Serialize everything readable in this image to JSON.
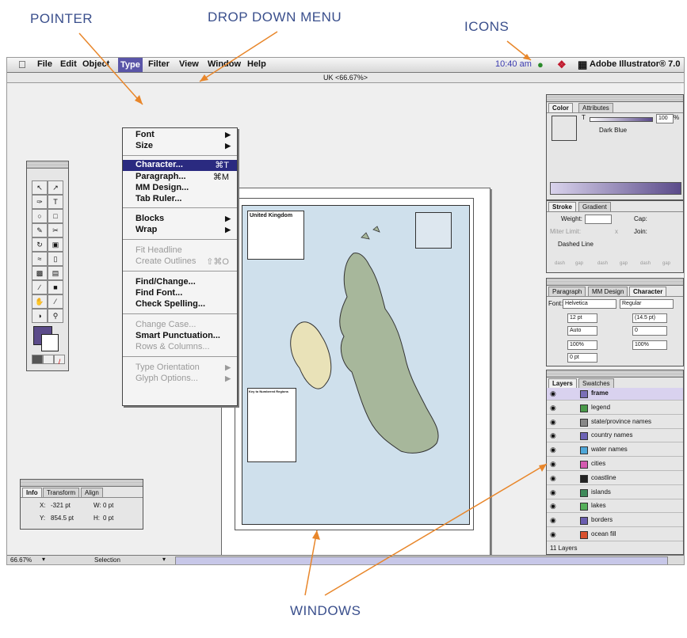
{
  "callouts": {
    "pointer": "POINTER",
    "dropdown": "DROP DOWN MENU",
    "icons": "ICONS",
    "windows": "WINDOWS"
  },
  "menubar": {
    "items": [
      "File",
      "Edit",
      "Object",
      "Type",
      "Filter",
      "View",
      "Window",
      "Help"
    ],
    "active": "Type",
    "clock": "10:40 am",
    "app_name": "Adobe Illustrator® 7.0",
    "icons": [
      "apple-icon",
      "lightbulb-icon",
      "flag-icon",
      "app-icon"
    ]
  },
  "document": {
    "title": "UK <66.67%>"
  },
  "type_menu": {
    "groups": [
      [
        {
          "label": "Font",
          "submenu": true
        },
        {
          "label": "Size",
          "submenu": true
        }
      ],
      [
        {
          "label": "Character...",
          "shortcut": "⌘T",
          "selected": true
        },
        {
          "label": "Paragraph...",
          "shortcut": "⌘M"
        },
        {
          "label": "MM Design..."
        },
        {
          "label": "Tab Ruler..."
        }
      ],
      [
        {
          "label": "Blocks",
          "submenu": true
        },
        {
          "label": "Wrap",
          "submenu": true
        }
      ],
      [
        {
          "label": "Fit Headline",
          "disabled": true
        },
        {
          "label": "Create Outlines",
          "shortcut": "⇧⌘O",
          "disabled": true
        }
      ],
      [
        {
          "label": "Find/Change..."
        },
        {
          "label": "Find Font..."
        },
        {
          "label": "Check Spelling..."
        }
      ],
      [
        {
          "label": "Change Case...",
          "disabled": true
        },
        {
          "label": "Smart Punctuation..."
        },
        {
          "label": "Rows & Columns...",
          "disabled": true
        }
      ],
      [
        {
          "label": "Type Orientation",
          "submenu": true,
          "disabled": true
        },
        {
          "label": "Glyph Options...",
          "submenu": true,
          "disabled": true
        }
      ]
    ]
  },
  "map": {
    "legend_title": "United Kingdom",
    "key_title": "Key to Numbered Regions"
  },
  "color_palette": {
    "tabs": [
      "Color",
      "Attributes"
    ],
    "tint_label": "T",
    "tint_value": "100",
    "tint_unit": "%",
    "color_name": "Dark Blue",
    "swatch_color": "#5b4b8a"
  },
  "stroke_palette": {
    "tabs": [
      "Stroke",
      "Gradient"
    ],
    "weight_label": "Weight:",
    "cap_label": "Cap:",
    "miter_label": "Miter Limit:",
    "miter_unit": "x",
    "join_label": "Join:",
    "dashed_label": "Dashed Line",
    "dash_labels": [
      "dash",
      "gap",
      "dash",
      "gap",
      "dash",
      "gap"
    ]
  },
  "character_palette": {
    "tabs": [
      "Paragraph",
      "MM Design",
      "Character"
    ],
    "font_label": "Font:",
    "font": "Helvetica",
    "style": "Regular",
    "size": "12 pt",
    "leading": "(14.5 pt)",
    "kerning": "Auto",
    "tracking": "0",
    "vertical_scale": "100%",
    "horizontal_scale": "100%",
    "baseline": "0 pt"
  },
  "layers_palette": {
    "tabs": [
      "Layers",
      "Swatches"
    ],
    "layers": [
      {
        "name": "frame",
        "color": "#7b6fb8",
        "bold": true
      },
      {
        "name": "legend",
        "color": "#4a9a4a"
      },
      {
        "name": "state/province names",
        "color": "#888888"
      },
      {
        "name": "country names",
        "color": "#6d63b5"
      },
      {
        "name": "water names",
        "color": "#4fa7d8"
      },
      {
        "name": "cities",
        "color": "#d45ab0"
      },
      {
        "name": "coastline",
        "color": "#222222"
      },
      {
        "name": "islands",
        "color": "#3f8a5a"
      },
      {
        "name": "lakes",
        "color": "#55b05a"
      },
      {
        "name": "borders",
        "color": "#6b5eb0"
      },
      {
        "name": "ocean fill",
        "color": "#d9502d"
      }
    ],
    "count_label": "11 Layers"
  },
  "info_palette": {
    "tabs": [
      "Info",
      "Transform",
      "Align"
    ],
    "x_label": "X:",
    "x_value": "-321 pt",
    "y_label": "Y:",
    "y_value": "854.5 pt",
    "w_label": "W:",
    "w_value": "0 pt",
    "h_label": "H:",
    "h_value": "0 pt"
  },
  "statusbar": {
    "zoom": "66.67%",
    "mode": "Selection"
  },
  "colors": {
    "accent": "#3a4f8c",
    "callout_arrow": "#e8862a",
    "menu_highlight": "#5a55a8",
    "layer_highlight": "#d9d2ef"
  }
}
